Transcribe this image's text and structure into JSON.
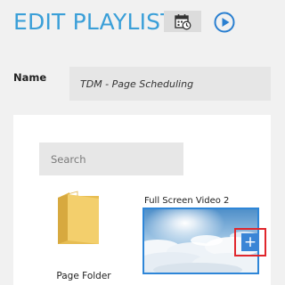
{
  "header": {
    "title": "EDIT PLAYLIST",
    "calendar_icon": "calendar-clock-icon",
    "play_icon": "play-circle-icon",
    "accent_color": "#3a9fd8"
  },
  "form": {
    "name_label": "Name",
    "name_value": "TDM - Page Scheduling"
  },
  "library": {
    "search_placeholder": "Search",
    "items": [
      {
        "type": "folder",
        "label": "Page Folder",
        "icon": "folder-icon"
      },
      {
        "type": "video",
        "label": "Full Screen Video 2",
        "add_icon": "plus-icon",
        "add_symbol": "+"
      }
    ]
  }
}
